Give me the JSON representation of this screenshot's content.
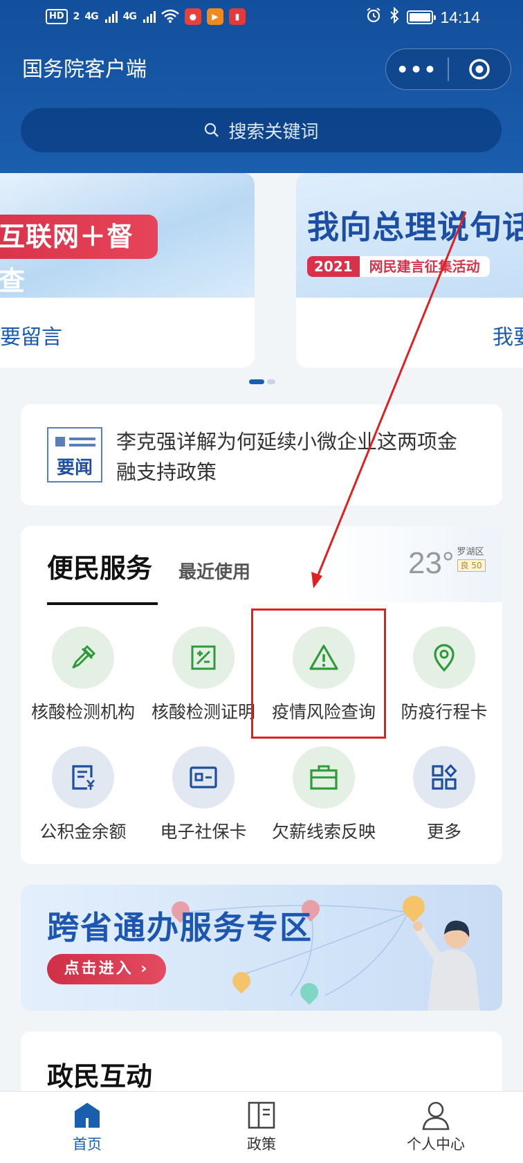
{
  "status_bar": {
    "hd": "HD",
    "sim_slot": "2",
    "network_1": "4G",
    "network_2": "4G",
    "time": "14:14"
  },
  "header": {
    "title": "国务院客户端",
    "more_label": "•••"
  },
  "search": {
    "placeholder": "搜索关键词"
  },
  "banners": [
    {
      "title": "互联网＋督查",
      "caption": "要留言"
    },
    {
      "title": "我向总理说句话",
      "year": "2021",
      "subtitle": "网民建言征集活动",
      "caption": "我要"
    }
  ],
  "news": {
    "icon_label": "要闻",
    "headline": "李克强详解为何延续小微企业这两项金融支持政策"
  },
  "services": {
    "tab_main": "便民服务",
    "tab_recent": "最近使用",
    "weather": {
      "temperature": "23°",
      "district": "罗湖区",
      "aqi": "良 50"
    },
    "items": [
      {
        "label": "核酸检测机构",
        "icon": "dropper-icon",
        "tone": "green"
      },
      {
        "label": "核酸检测证明",
        "icon": "certificate-icon",
        "tone": "green"
      },
      {
        "label": "疫情风险查询",
        "icon": "warning-icon",
        "tone": "green"
      },
      {
        "label": "防疫行程卡",
        "icon": "location-pin-icon",
        "tone": "green"
      },
      {
        "label": "公积金余额",
        "icon": "fund-document-icon",
        "tone": "blue"
      },
      {
        "label": "电子社保卡",
        "icon": "id-card-icon",
        "tone": "blue"
      },
      {
        "label": "欠薪线索反映",
        "icon": "briefcase-icon",
        "tone": "green"
      },
      {
        "label": "更多",
        "icon": "grid-more-icon",
        "tone": "blue"
      }
    ]
  },
  "cross_province": {
    "title": "跨省通办服务专区",
    "button": "点击进入 ›"
  },
  "interaction": {
    "title": "政民互动"
  },
  "bottom_nav": [
    {
      "label": "首页",
      "icon": "home-icon",
      "active": true
    },
    {
      "label": "政策",
      "icon": "book-icon",
      "active": false
    },
    {
      "label": "个人中心",
      "icon": "user-icon",
      "active": false
    }
  ],
  "colors": {
    "brand_blue": "#1a5eae",
    "accent_red": "#d8324a",
    "service_green": "#2e9a3a",
    "service_blue": "#1f4f9c",
    "annotation_red": "#e02020"
  }
}
